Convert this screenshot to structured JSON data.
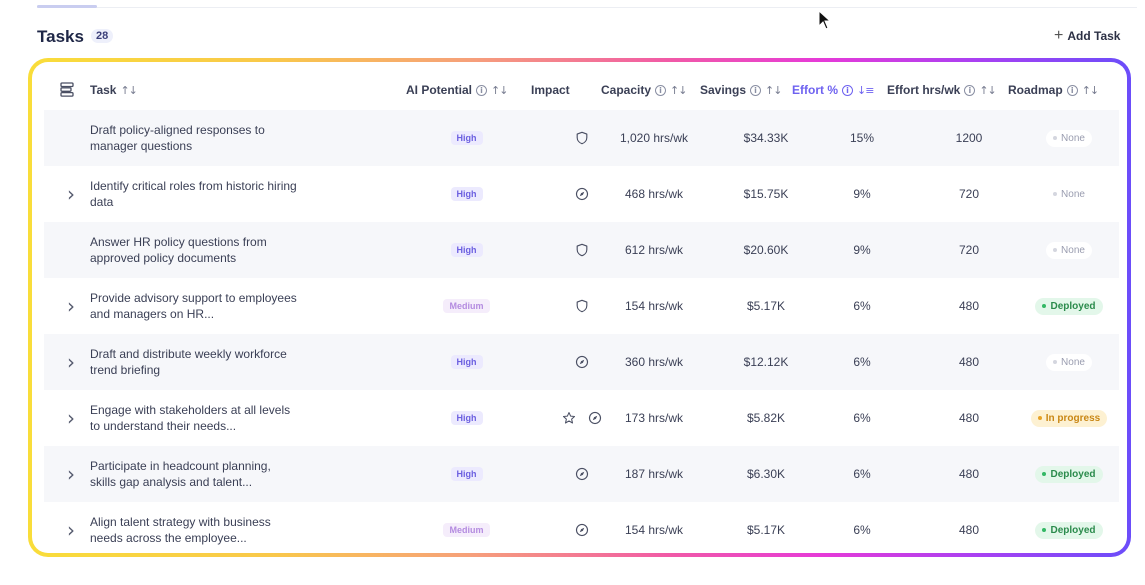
{
  "header": {
    "title": "Tasks",
    "count": "28",
    "add_task_label": "Add Task"
  },
  "columns": {
    "task": "Task",
    "ai_potential": "AI Potential",
    "impact": "Impact",
    "capacity": "Capacity",
    "savings": "Savings",
    "effort_pct": "Effort %",
    "effort_hrs": "Effort hrs/wk",
    "roadmap": "Roadmap"
  },
  "colors": {
    "active_sort": "#6e62f0",
    "deployed": "#2b8b4c",
    "in_progress": "#c98716"
  },
  "rows": [
    {
      "expandable": false,
      "task": "Draft policy-aligned responses to manager questions",
      "ai": "High",
      "impact": [
        "shield-icon"
      ],
      "capacity": "1,020 hrs/wk",
      "savings": "$34.33K",
      "effort_pct": "15%",
      "effort_hrs": "1200",
      "roadmap": "None",
      "roadmap_state": "none"
    },
    {
      "expandable": true,
      "task": "Identify critical roles from historic hiring data",
      "ai": "High",
      "impact": [
        "compass-icon"
      ],
      "capacity": "468 hrs/wk",
      "savings": "$15.75K",
      "effort_pct": "9%",
      "effort_hrs": "720",
      "roadmap": "None",
      "roadmap_state": "none"
    },
    {
      "expandable": false,
      "task": "Answer HR policy questions from approved policy documents",
      "ai": "High",
      "impact": [
        "shield-icon"
      ],
      "capacity": "612 hrs/wk",
      "savings": "$20.60K",
      "effort_pct": "9%",
      "effort_hrs": "720",
      "roadmap": "None",
      "roadmap_state": "none"
    },
    {
      "expandable": true,
      "task": "Provide advisory support to employees and managers on HR...",
      "ai": "Medium",
      "impact": [
        "shield-icon"
      ],
      "capacity": "154 hrs/wk",
      "savings": "$5.17K",
      "effort_pct": "6%",
      "effort_hrs": "480",
      "roadmap": "Deployed",
      "roadmap_state": "deployed"
    },
    {
      "expandable": true,
      "task": "Draft and distribute weekly workforce trend briefing",
      "ai": "High",
      "impact": [
        "compass-icon"
      ],
      "capacity": "360 hrs/wk",
      "savings": "$12.12K",
      "effort_pct": "6%",
      "effort_hrs": "480",
      "roadmap": "None",
      "roadmap_state": "none"
    },
    {
      "expandable": true,
      "task": "Engage with stakeholders at all levels to understand their needs...",
      "ai": "High",
      "impact": [
        "star-icon",
        "compass-icon"
      ],
      "capacity": "173 hrs/wk",
      "savings": "$5.82K",
      "effort_pct": "6%",
      "effort_hrs": "480",
      "roadmap": "In progress",
      "roadmap_state": "progress"
    },
    {
      "expandable": true,
      "task": "Participate in headcount planning, skills gap analysis and talent...",
      "ai": "High",
      "impact": [
        "compass-icon"
      ],
      "capacity": "187 hrs/wk",
      "savings": "$6.30K",
      "effort_pct": "6%",
      "effort_hrs": "480",
      "roadmap": "Deployed",
      "roadmap_state": "deployed"
    },
    {
      "expandable": true,
      "task": "Align talent strategy with business needs across the employee...",
      "ai": "Medium",
      "impact": [
        "compass-icon"
      ],
      "capacity": "154 hrs/wk",
      "savings": "$5.17K",
      "effort_pct": "6%",
      "effort_hrs": "480",
      "roadmap": "Deployed",
      "roadmap_state": "deployed"
    }
  ]
}
